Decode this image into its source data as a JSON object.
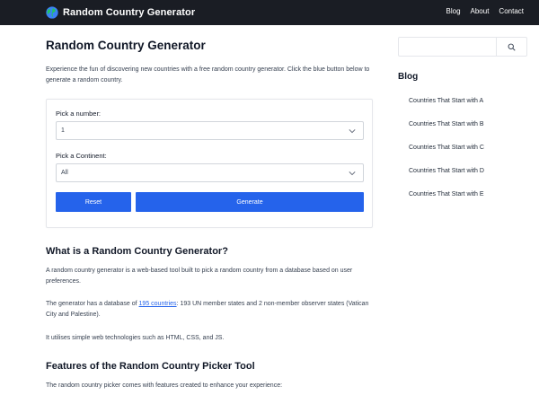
{
  "header": {
    "brand": "Random Country Generator",
    "nav": [
      "Blog",
      "About",
      "Contact"
    ]
  },
  "main": {
    "title": "Random Country Generator",
    "intro": "Experience the fun of discovering new countries with a free random country generator. Click the blue button below to generate a random country.",
    "form": {
      "number_label": "Pick a number:",
      "number_value": "1",
      "continent_label": "Pick a Continent:",
      "continent_value": "All",
      "reset_label": "Reset",
      "generate_label": "Generate"
    },
    "section1": {
      "heading": "What is a Random Country Generator?",
      "p1": "A random country generator is a web-based tool built to pick a random country from a database based on user preferences.",
      "p2_before": "The generator has a database of ",
      "p2_link": "195 countries",
      "p2_after": ": 193 UN member states and 2 non-member observer states (Vatican City and Palestine).",
      "p3": "It utilises simple web technologies such as HTML, CSS, and JS."
    },
    "section2": {
      "heading": "Features of the Random Country Picker Tool",
      "p1": "The random country picker comes with features created to enhance your experience:"
    }
  },
  "sidebar": {
    "search_placeholder": "",
    "blog_title": "Blog",
    "blog_items": [
      "Countries That Start with A",
      "Countries That Start with B",
      "Countries That Start with C",
      "Countries That Start with D",
      "Countries That Start with E"
    ]
  },
  "colors": {
    "accent": "#2563eb",
    "header_bg": "#1a1d24"
  },
  "icons": {
    "brand": "globe-icon",
    "search": "search-icon",
    "dropdown": "chevron-down-icon"
  }
}
